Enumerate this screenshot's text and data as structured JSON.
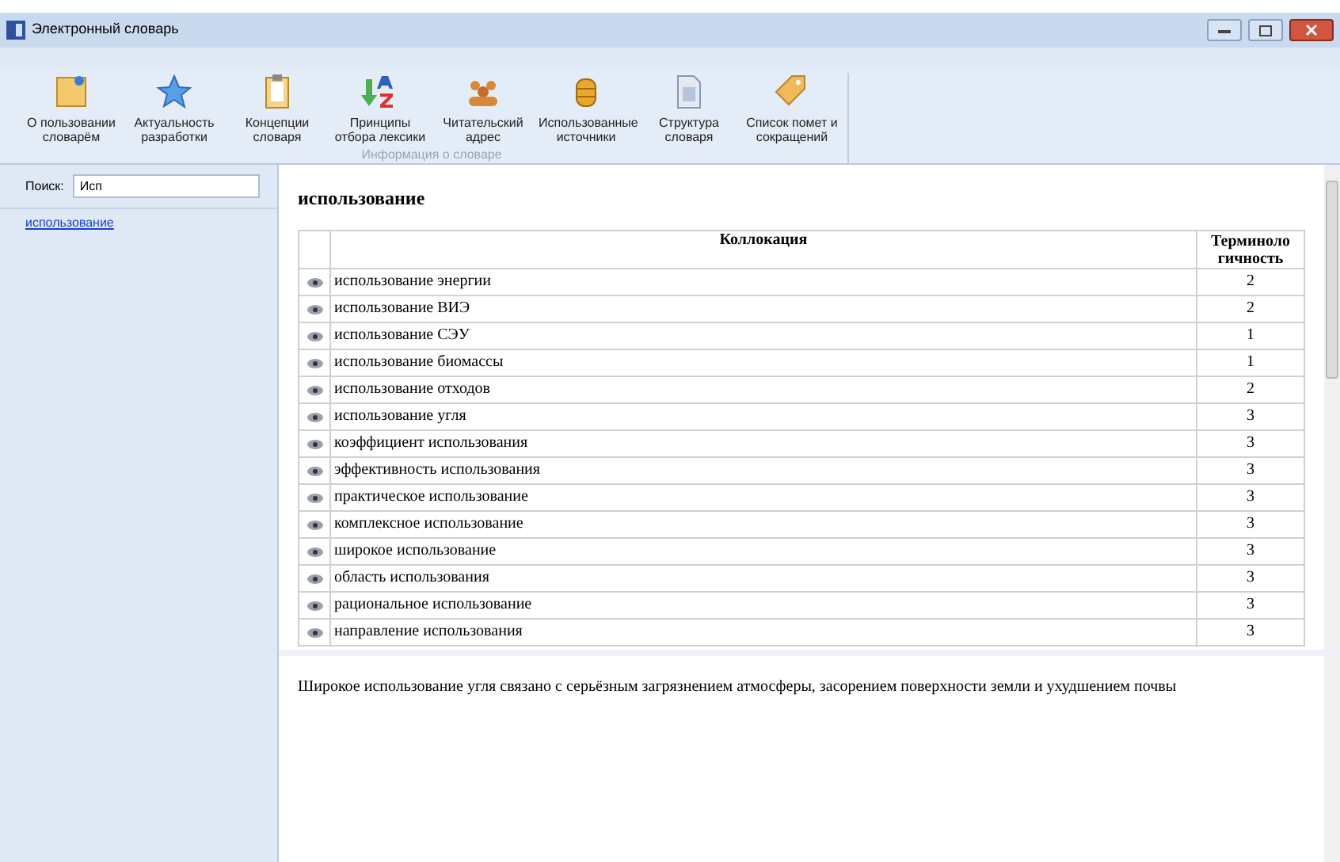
{
  "window": {
    "title": "Электронный словарь"
  },
  "ribbon": {
    "group_label": "Информация о словаре",
    "buttons": [
      {
        "kind": "note",
        "label": "О пользовании словарём"
      },
      {
        "kind": "star",
        "label": "Актуальность разработки"
      },
      {
        "kind": "clipboard",
        "label": "Концепции словаря"
      },
      {
        "kind": "sort",
        "label": "Принципы отбора лексики"
      },
      {
        "kind": "people",
        "label": "Читательский адрес"
      },
      {
        "kind": "database",
        "label": "Использованные источники"
      },
      {
        "kind": "document",
        "label": "Структура словаря"
      },
      {
        "kind": "tag",
        "label": "Список помет и сокращений"
      }
    ]
  },
  "search": {
    "label": "Поиск:",
    "value": "Исп"
  },
  "results": [
    {
      "label": "использование",
      "selected": true
    }
  ],
  "entry": {
    "headword": "использование",
    "table": {
      "columns": [
        "Коллокация",
        "Терминоло гичность"
      ],
      "rows": [
        {
          "collocation": "использование энергии",
          "level": "2"
        },
        {
          "collocation": "использование ВИЭ",
          "level": "2"
        },
        {
          "collocation": "использование СЭУ",
          "level": "1"
        },
        {
          "collocation": "использование биомассы",
          "level": "1"
        },
        {
          "collocation": "использование отходов",
          "level": "2"
        },
        {
          "collocation": "использование угля",
          "level": "3"
        },
        {
          "collocation": "коэффициент использования",
          "level": "3"
        },
        {
          "collocation": "эффективность использования",
          "level": "3"
        },
        {
          "collocation": "практическое использование",
          "level": "3"
        },
        {
          "collocation": "комплексное использование",
          "level": "3"
        },
        {
          "collocation": "широкое использование",
          "level": "3"
        },
        {
          "collocation": "область использования",
          "level": "3"
        },
        {
          "collocation": "рациональное использование",
          "level": "3"
        },
        {
          "collocation": "направление использования",
          "level": "3"
        }
      ]
    }
  },
  "example": "Широкое использование угля связано с серьёзным загрязнением атмосферы, засорением поверхности земли и ухудшением почвы"
}
